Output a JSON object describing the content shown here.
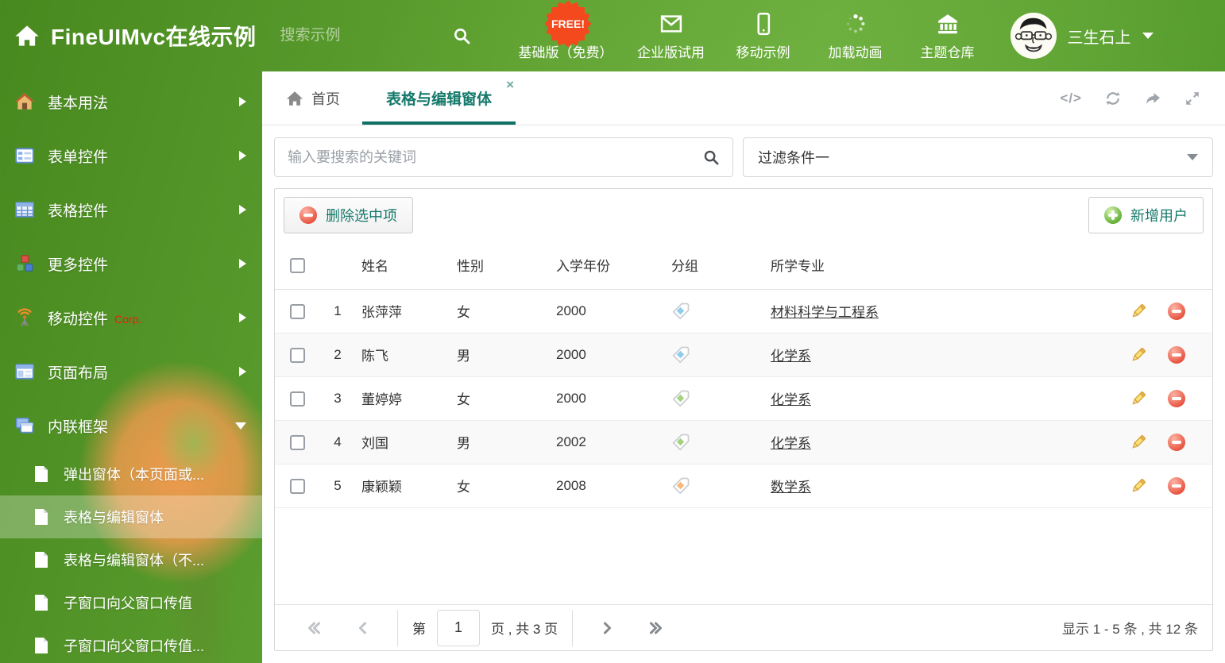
{
  "header": {
    "title": "FineUIMvc在线示例",
    "search_placeholder": "搜索示例",
    "free_badge": "FREE!",
    "nav": [
      {
        "label": "基础版（免费）",
        "icon": "download-icon"
      },
      {
        "label": "企业版试用",
        "icon": "envelope-icon"
      },
      {
        "label": "移动示例",
        "icon": "phone-icon"
      },
      {
        "label": "加载动画",
        "icon": "spinner-icon"
      },
      {
        "label": "主题仓库",
        "icon": "bank-icon"
      }
    ],
    "username": "三生石上"
  },
  "sidebar": {
    "items": [
      {
        "label": "基本用法",
        "icon": "home-icon"
      },
      {
        "label": "表单控件",
        "icon": "form-icon"
      },
      {
        "label": "表格控件",
        "icon": "table-icon"
      },
      {
        "label": "更多控件",
        "icon": "cubes-icon"
      },
      {
        "label": "移动控件",
        "badge": "Corp.",
        "icon": "antenna-icon"
      },
      {
        "label": "页面布局",
        "icon": "layout-icon"
      },
      {
        "label": "内联框架",
        "icon": "frames-icon",
        "expanded": true
      }
    ],
    "subitems": [
      {
        "label": "弹出窗体（本页面或..."
      },
      {
        "label": "表格与编辑窗体",
        "selected": true
      },
      {
        "label": "表格与编辑窗体（不..."
      },
      {
        "label": "子窗口向父窗口传值"
      },
      {
        "label": "子窗口向父窗口传值..."
      }
    ]
  },
  "tabs": {
    "home": "首页",
    "active": "表格与编辑窗体"
  },
  "filters": {
    "search_placeholder": "输入要搜索的关键词",
    "filter_value": "过滤条件一"
  },
  "toolbar": {
    "delete_label": "删除选中项",
    "add_label": "新增用户"
  },
  "grid": {
    "columns": {
      "name": "姓名",
      "gender": "性别",
      "year": "入学年份",
      "group": "分组",
      "major": "所学专业"
    },
    "rows": [
      {
        "num": "1",
        "name": "张萍萍",
        "gender": "女",
        "year": "2000",
        "tag": "blue",
        "major": "材料科学与工程系"
      },
      {
        "num": "2",
        "name": "陈飞",
        "gender": "男",
        "year": "2000",
        "tag": "blue",
        "major": "化学系"
      },
      {
        "num": "3",
        "name": "董婷婷",
        "gender": "女",
        "year": "2000",
        "tag": "green",
        "major": "化学系"
      },
      {
        "num": "4",
        "name": "刘国",
        "gender": "男",
        "year": "2002",
        "tag": "green",
        "major": "化学系"
      },
      {
        "num": "5",
        "name": "康颖颖",
        "gender": "女",
        "year": "2008",
        "tag": "orange",
        "major": "数学系"
      }
    ]
  },
  "pagination": {
    "prefix": "第",
    "page": "1",
    "suffix": "页 , 共 3 页",
    "info": "显示 1 - 5 条 , 共 12 条"
  },
  "colors": {
    "accent_teal": "#15796b",
    "header_green": "#5d9f30",
    "free_badge": "#f4491d",
    "corp_red": "#ff1414",
    "tag_blue": "#90cbf0",
    "tag_green": "#a5d37f",
    "tag_orange": "#f9b877",
    "delete_red": "#e44c38",
    "add_green": "#5aa82c"
  }
}
